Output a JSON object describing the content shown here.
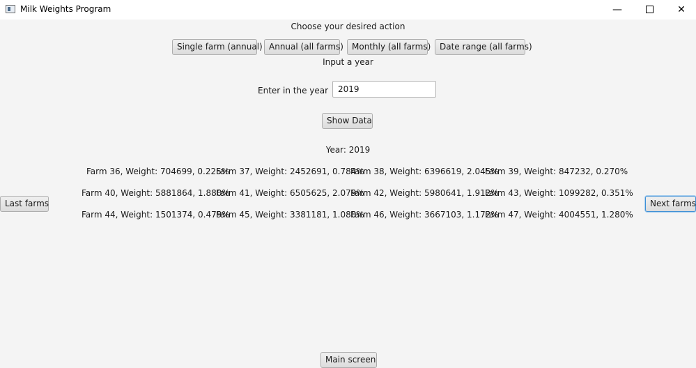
{
  "window": {
    "title": "Milk Weights Program",
    "minimize_glyph": "—",
    "close_glyph": "✕"
  },
  "actions": {
    "prompt": "Choose your desired action",
    "buttons": [
      "Single farm (annual)",
      "Annual (all farms)",
      "Monthly (all farms)",
      "Date range (all farms)"
    ]
  },
  "year_form": {
    "heading": "Input a year",
    "field_label": "Enter in the year",
    "field_value": "2019",
    "submit_label": "Show Data"
  },
  "results": {
    "year_label": "Year: 2019",
    "rows": [
      [
        "Farm 36, Weight: 704699, 0.225%",
        "Farm 37, Weight: 2452691, 0.784%",
        "Farm 38, Weight: 6396619, 2.045%",
        "Farm 39, Weight: 847232, 0.270%"
      ],
      [
        "Farm 40, Weight: 5881864, 1.880%",
        "Farm 41, Weight: 6505625, 2.079%",
        "Farm 42, Weight: 5980641, 1.912%",
        "Farm 43, Weight: 1099282, 0.351%"
      ],
      [
        "Farm 44, Weight: 1501374, 0.479%",
        "Farm 45, Weight: 3381181, 1.080%",
        "Farm 46, Weight: 3667103, 1.172%",
        "Farm 47, Weight: 4004551, 1.280%"
      ]
    ]
  },
  "navigation": {
    "prev_label": "Last farms",
    "next_label": "Next farms",
    "main_label": "Main screen"
  }
}
